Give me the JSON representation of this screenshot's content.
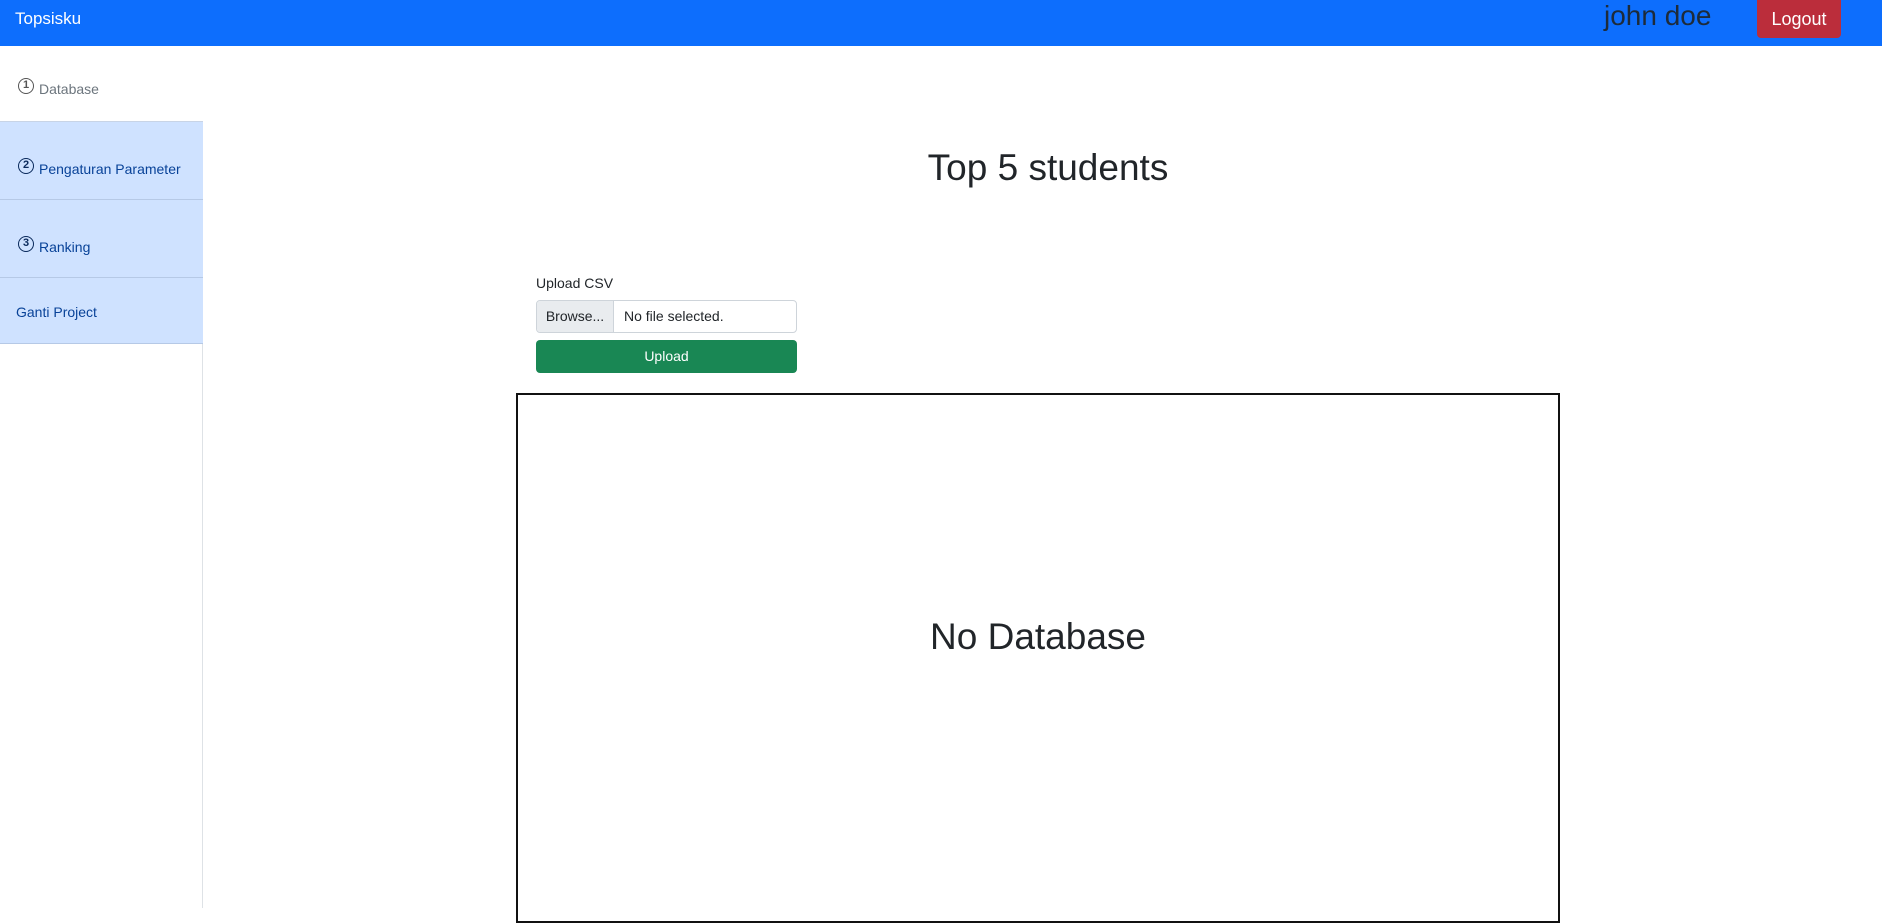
{
  "navbar": {
    "brand": "Topsisku",
    "username": "john doe",
    "logout_label": "Logout",
    "bg_color": "#0d6efd"
  },
  "sidebar": {
    "items": [
      {
        "number": "1",
        "label": "Database",
        "state": "active"
      },
      {
        "number": "2",
        "label": "Pengaturan Parameter",
        "state": "inactive"
      },
      {
        "number": "3",
        "label": "Ranking",
        "state": "inactive"
      },
      {
        "number": "",
        "label": "Ganti Project",
        "state": "inactive"
      }
    ]
  },
  "main": {
    "title": "Top 5 students",
    "upload": {
      "label": "Upload CSV",
      "browse_label": "Browse...",
      "file_status": "No file selected.",
      "button_label": "Upload",
      "button_color": "#198754"
    },
    "database": {
      "empty_message": "No Database"
    }
  }
}
